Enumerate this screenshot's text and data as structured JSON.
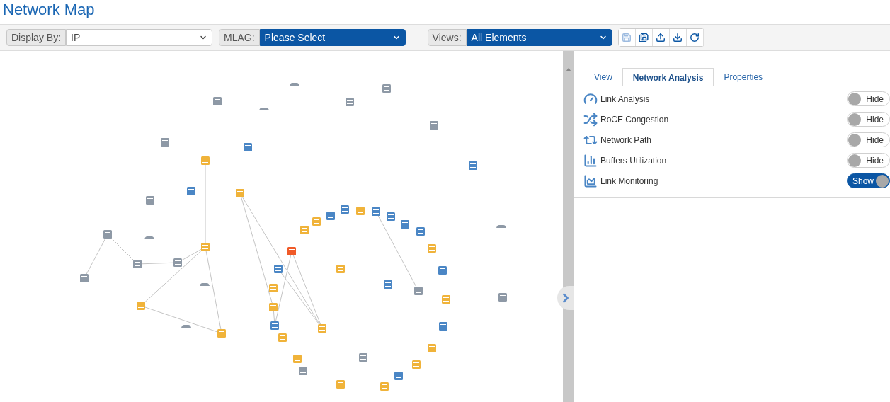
{
  "title": "Network Map",
  "toolbar": {
    "selects": [
      {
        "label": "Display By:",
        "value": "IP"
      },
      {
        "label": "MLAG:",
        "value": "Please Select"
      },
      {
        "label": "Views:",
        "value": "All Elements"
      }
    ],
    "buttons": [
      {
        "disabled": true
      },
      {
        "disabled": false
      },
      {
        "disabled": false
      },
      {
        "disabled": false
      },
      {
        "disabled": false
      }
    ]
  },
  "map": {
    "nodes": [
      {
        "kind": "host",
        "color": "#8e99a6"
      },
      {
        "kind": "switch",
        "color": "#8e99a6"
      },
      {
        "kind": "host",
        "color": "#8e99a6"
      },
      {
        "kind": "switch",
        "color": "#8e99a6"
      },
      {
        "kind": "switch",
        "color": "#8e99a6"
      },
      {
        "kind": "switch",
        "color": "#8e99a6"
      },
      {
        "kind": "switch",
        "color": "#8e99a6"
      },
      {
        "kind": "switch",
        "color": "#4a86c5"
      },
      {
        "kind": "switch",
        "color": "#f0b33a"
      },
      {
        "kind": "switch",
        "color": "#4a86c5"
      },
      {
        "kind": "switch",
        "color": "#4a86c5"
      },
      {
        "kind": "switch",
        "color": "#f0b33a"
      },
      {
        "kind": "switch",
        "color": "#8e99a6"
      },
      {
        "kind": "host",
        "color": "#8e99a6"
      },
      {
        "kind": "switch",
        "color": "#8e99a6"
      },
      {
        "kind": "host",
        "color": "#8e99a6"
      },
      {
        "kind": "switch",
        "color": "#f0b33a"
      },
      {
        "kind": "switch",
        "color": "#8e99a6"
      },
      {
        "kind": "switch",
        "color": "#8e99a6"
      },
      {
        "kind": "switch",
        "color": "#8e99a6"
      },
      {
        "kind": "switch",
        "color": "#f05a28"
      },
      {
        "kind": "switch",
        "color": "#4a86c5"
      },
      {
        "kind": "host",
        "color": "#8e99a6"
      },
      {
        "kind": "switch",
        "color": "#f0b33a"
      },
      {
        "kind": "switch",
        "color": "#f0b33a"
      },
      {
        "kind": "switch",
        "color": "#f0b33a"
      },
      {
        "kind": "switch",
        "color": "#4a86c5"
      },
      {
        "kind": "switch",
        "color": "#f0b33a"
      },
      {
        "kind": "switch",
        "color": "#f0b33a"
      },
      {
        "kind": "host",
        "color": "#8e99a6"
      },
      {
        "kind": "switch",
        "color": "#f0b33a"
      },
      {
        "kind": "switch",
        "color": "#f0b33a"
      },
      {
        "kind": "switch",
        "color": "#8e99a6"
      },
      {
        "kind": "switch",
        "color": "#f0b33a"
      },
      {
        "kind": "switch",
        "color": "#8e99a6"
      },
      {
        "kind": "switch",
        "color": "#f0b33a"
      },
      {
        "kind": "switch",
        "color": "#4a86c5"
      },
      {
        "kind": "switch",
        "color": "#f0b33a"
      },
      {
        "kind": "switch",
        "color": "#f0b33a"
      },
      {
        "kind": "switch",
        "color": "#4a86c5"
      },
      {
        "kind": "switch",
        "color": "#f0b33a"
      },
      {
        "kind": "switch",
        "color": "#8e99a6"
      },
      {
        "kind": "switch",
        "color": "#4a86c5"
      },
      {
        "kind": "switch",
        "color": "#f0b33a"
      },
      {
        "kind": "switch",
        "color": "#4a86c5"
      },
      {
        "kind": "switch",
        "color": "#f0b33a"
      },
      {
        "kind": "switch",
        "color": "#4a86c5"
      },
      {
        "kind": "switch",
        "color": "#4a86c5"
      },
      {
        "kind": "switch",
        "color": "#4a86c5"
      },
      {
        "kind": "switch",
        "color": "#4a86c5"
      },
      {
        "kind": "switch",
        "color": "#f0b33a"
      },
      {
        "kind": "switch",
        "color": "#4a86c5"
      },
      {
        "kind": "switch",
        "color": "#4a86c5"
      },
      {
        "kind": "switch",
        "color": "#f0b33a"
      },
      {
        "kind": "switch",
        "color": "#f0b33a"
      },
      {
        "kind": "switch",
        "color": "#8e99a6"
      }
    ]
  },
  "panel": {
    "tabs": [
      {
        "label": "View",
        "selected": false
      },
      {
        "label": "Network Analysis",
        "selected": true
      },
      {
        "label": "Properties",
        "selected": false
      }
    ],
    "rows": [
      {
        "label": "Link Analysis",
        "on": false,
        "toggle_text": "Hide"
      },
      {
        "label": "RoCE Congestion",
        "on": false,
        "toggle_text": "Hide"
      },
      {
        "label": "Network Path",
        "on": false,
        "toggle_text": "Hide"
      },
      {
        "label": "Buffers Utilization",
        "on": false,
        "toggle_text": "Hide"
      },
      {
        "label": "Link Monitoring",
        "on": true,
        "toggle_text": "Show"
      }
    ]
  }
}
